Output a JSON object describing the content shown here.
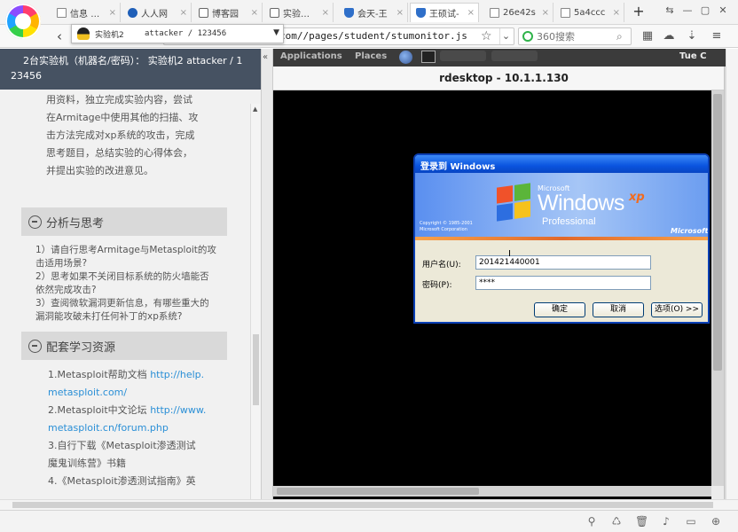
{
  "browser": {
    "tabs": [
      {
        "label": "信息 近 E",
        "icon": "doc",
        "active": false
      },
      {
        "label": "人人网 ",
        "icon": "renren",
        "active": false
      },
      {
        "label": "博客园",
        "icon": "cnblog",
        "active": false
      },
      {
        "label": "实验报告",
        "icon": "cnblog",
        "active": false
      },
      {
        "label": "会天-王",
        "icon": "shield",
        "active": false
      },
      {
        "label": "王硕试-",
        "icon": "shield",
        "active": true
      },
      {
        "label": "26e42s ",
        "icon": "doc",
        "active": false
      },
      {
        "label": "5a4ccc ",
        "icon": "doc",
        "active": false
      }
    ],
    "new_tab": "+",
    "window_controls": {
      "menu": "⇆",
      "minimize": "—",
      "restore": "▢",
      "close": "✕"
    },
    "nav": {
      "back": "‹",
      "forward": "›",
      "refresh": "↻",
      "undo": "↶",
      "favorite": "☆"
    },
    "url": "cppsu.hetianlab.com//pages/student/stumonitor.js",
    "search_placeholder": "360搜索",
    "tools": {
      "apps": "▦",
      "cloud": "☁",
      "download": "⇣",
      "menu": "≡"
    }
  },
  "left_panel": {
    "header_line1": "2台实验机（机器名/密码）：  实验机2    attacker / 1",
    "header_line2": "23456",
    "machine_select": {
      "name": "实验机2",
      "credentials": "attacker / 123456"
    },
    "intro_lines": [
      "用资料，独立完成实验内容，尝试",
      "在Armitage中使用其他的扫描、攻",
      "击方法完成对xp系统的攻击，完成",
      "思考题目，总结实验的心得体会，",
      "并提出实验的改进意见。"
    ],
    "analysis": {
      "title": "分析与思考",
      "questions": [
        "1）请自行思考Armitage与Metasploit的攻",
        "击适用场景?",
        "2）思考如果不关闭目标系统的防火墙能否",
        "依然完成攻击?",
        "3）查阅微软漏洞更新信息，有哪些重大的",
        "漏洞能攻破未打任何补丁的xp系统?"
      ]
    },
    "resources": {
      "title": "配套学习资源",
      "items": [
        {
          "text": "1.Metasploit帮助文档 ",
          "link": "http://help."
        },
        {
          "text": "",
          "link": "metasploit.com/"
        },
        {
          "text": "2.Metasploit中文论坛 ",
          "link": "http://www."
        },
        {
          "text": "",
          "link": "metasploit.cn/forum.php"
        },
        {
          "text": "3.自行下载《Metasploit渗透测试",
          "link": ""
        },
        {
          "text": "魔鬼训练营》书籍",
          "link": ""
        },
        {
          "text": "4.《Metasploit渗透测试指南》英",
          "link": ""
        }
      ]
    }
  },
  "remote": {
    "gnome_apps": "Applications",
    "gnome_places": "Places",
    "gnome_clock": "Tue C",
    "window_title": "rdesktop - 10.1.1.130",
    "xp_dialog": {
      "title": "登录到 Windows",
      "brand_microsoft": "Microsoft",
      "brand_windows": "Windows",
      "brand_xp": "xp",
      "brand_edition": "Professional",
      "copyright": "Copyright © 1985-2001\nMicrosoft Corporation",
      "ms_logo": "Microsoft",
      "username_label": "用户名(U):",
      "username_value": "201421440001",
      "password_label": "密码(P):",
      "password_value": "****",
      "ok_button": "确定",
      "cancel_button": "取消",
      "options_button": "选项(O) >>"
    }
  },
  "statusbar": {
    "icons": [
      "pin-icon",
      "share-icon",
      "trash-icon",
      "sound-icon",
      "window-icon",
      "zoom-icon"
    ]
  }
}
